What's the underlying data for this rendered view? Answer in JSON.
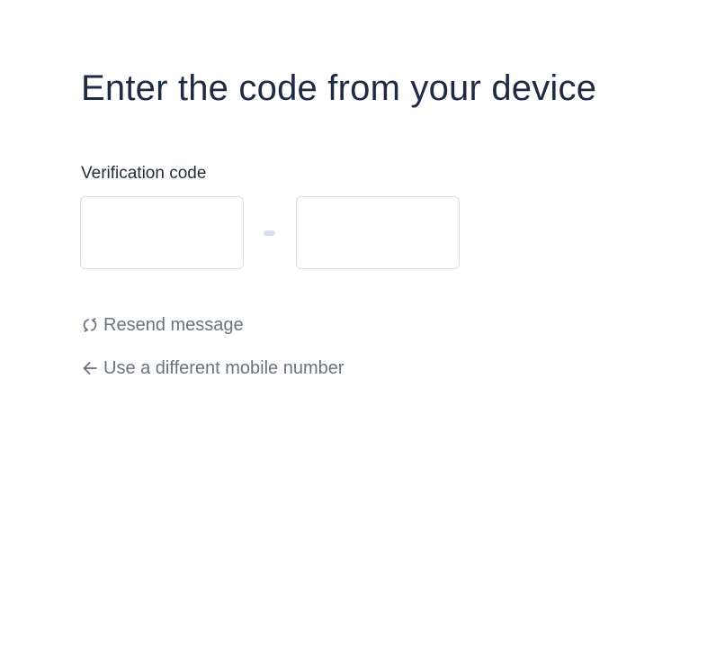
{
  "page": {
    "title": "Enter the code from your device"
  },
  "verification": {
    "label": "Verification code",
    "first_group": [
      "",
      "",
      ""
    ],
    "second_group": [
      "",
      "",
      ""
    ]
  },
  "actions": {
    "resend_label": "Resend message",
    "resend_icon": "refresh-icon",
    "different_number_label": "Use a different mobile number",
    "different_number_icon": "arrow-left-icon"
  },
  "colors": {
    "title": "#1f2a44",
    "link": "#6b7280",
    "border": "#d8dde4",
    "separator": "#d7e0ef"
  }
}
